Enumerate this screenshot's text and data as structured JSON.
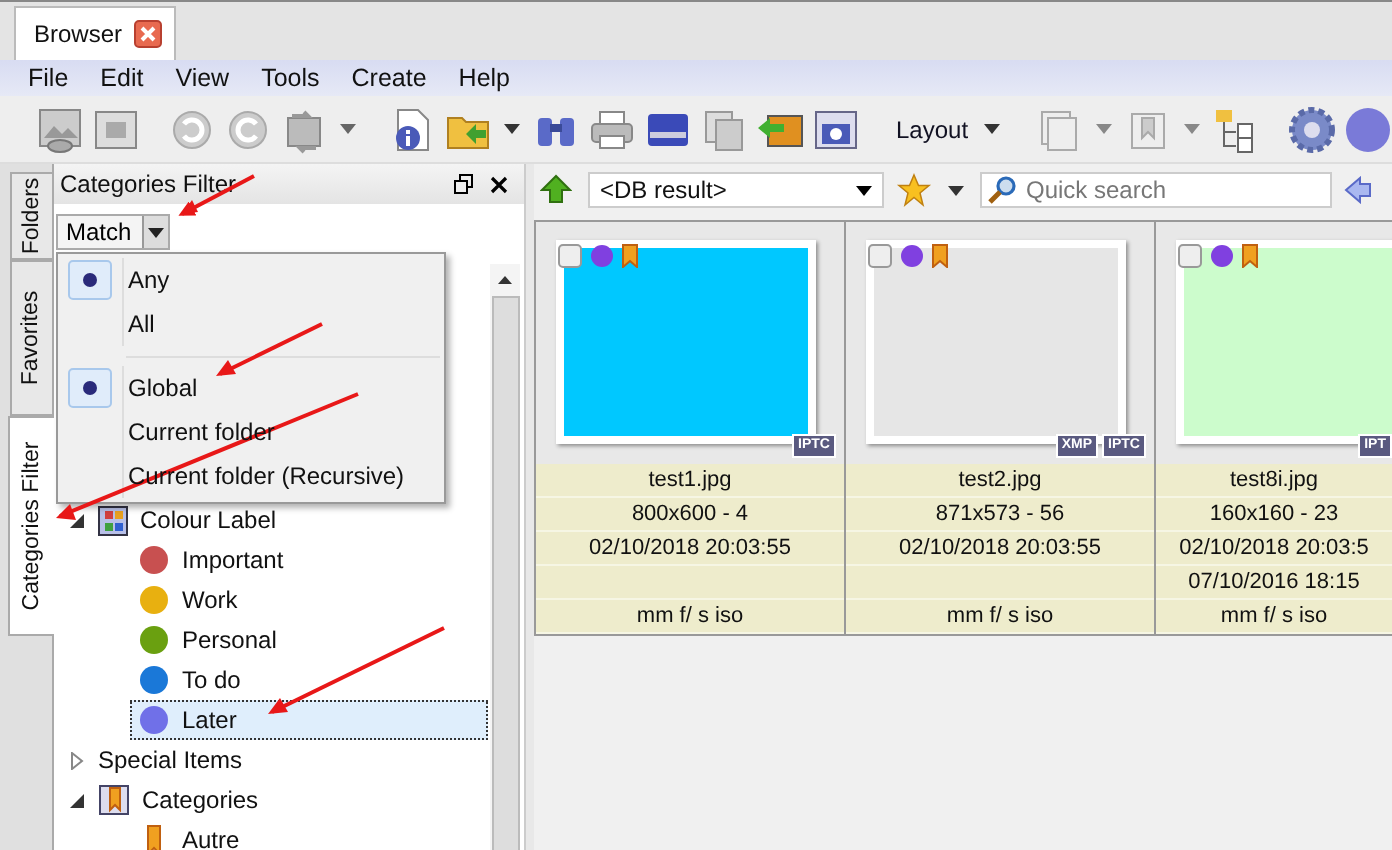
{
  "tabs": [
    {
      "label": "Browser",
      "selected": true
    }
  ],
  "menu": [
    "File",
    "Edit",
    "View",
    "Tools",
    "Create",
    "Help"
  ],
  "toolbar": {
    "layout_button": "Layout"
  },
  "side_tabs": [
    {
      "label": "Folders",
      "selected": false
    },
    {
      "label": "Favorites",
      "selected": false
    },
    {
      "label": "Categories Filter",
      "selected": true
    }
  ],
  "panel": {
    "title": "Categories Filter",
    "match_button": "Match"
  },
  "match_menu": [
    [
      {
        "label": "Any",
        "selected": true
      },
      {
        "label": "All",
        "selected": false
      }
    ],
    [
      {
        "label": "Global",
        "selected": true
      },
      {
        "label": "Current folder",
        "selected": false
      },
      {
        "label": "Current folder (Recursive)",
        "selected": false
      }
    ]
  ],
  "tree": [
    {
      "label": "Colour Label",
      "kind": "palette",
      "expanded": true,
      "selected": false,
      "children": [
        {
          "label": "Important",
          "kind": "dot",
          "color": "#c85050",
          "selected": false
        },
        {
          "label": "Work",
          "kind": "dot",
          "color": "#e8b010",
          "selected": false
        },
        {
          "label": "Personal",
          "kind": "dot",
          "color": "#6aa010",
          "selected": false
        },
        {
          "label": "To do",
          "kind": "dot",
          "color": "#1a78d8",
          "selected": false
        },
        {
          "label": "Later",
          "kind": "dot",
          "color": "#7070e8",
          "selected": true
        }
      ]
    },
    {
      "label": "Special Items",
      "kind": "plain",
      "expanded": false,
      "selected": false
    },
    {
      "label": "Categories",
      "kind": "bookmarks",
      "expanded": true,
      "selected": false,
      "children": [
        {
          "label": "Autre",
          "kind": "bookmark",
          "selected": false
        }
      ]
    }
  ],
  "browser": {
    "location": "<DB result>",
    "search": {
      "placeholder": "Quick search"
    }
  },
  "thumbnails": [
    {
      "name": "test1.jpg",
      "size": "800x600 - 4",
      "dates": [
        "02/10/2018 20:03:55"
      ],
      "exif": "mm f/ s iso",
      "color": "#00c8ff",
      "badges": [
        "IPTC"
      ],
      "checked": false
    },
    {
      "name": "test2.jpg",
      "size": "871x573 - 56",
      "dates": [
        "02/10/2018 20:03:55"
      ],
      "exif": "mm f/ s iso",
      "color": "#e6e6e6",
      "badges": [
        "XMP",
        "IPTC"
      ],
      "checked": false
    },
    {
      "name": "test8i.jpg",
      "size": "160x160 - 23",
      "dates": [
        "02/10/2018 20:03:5",
        "07/10/2016 18:15"
      ],
      "exif": "mm f/ s iso",
      "color": "#ccfccc",
      "badges": [
        "IPT"
      ],
      "checked": false
    }
  ]
}
